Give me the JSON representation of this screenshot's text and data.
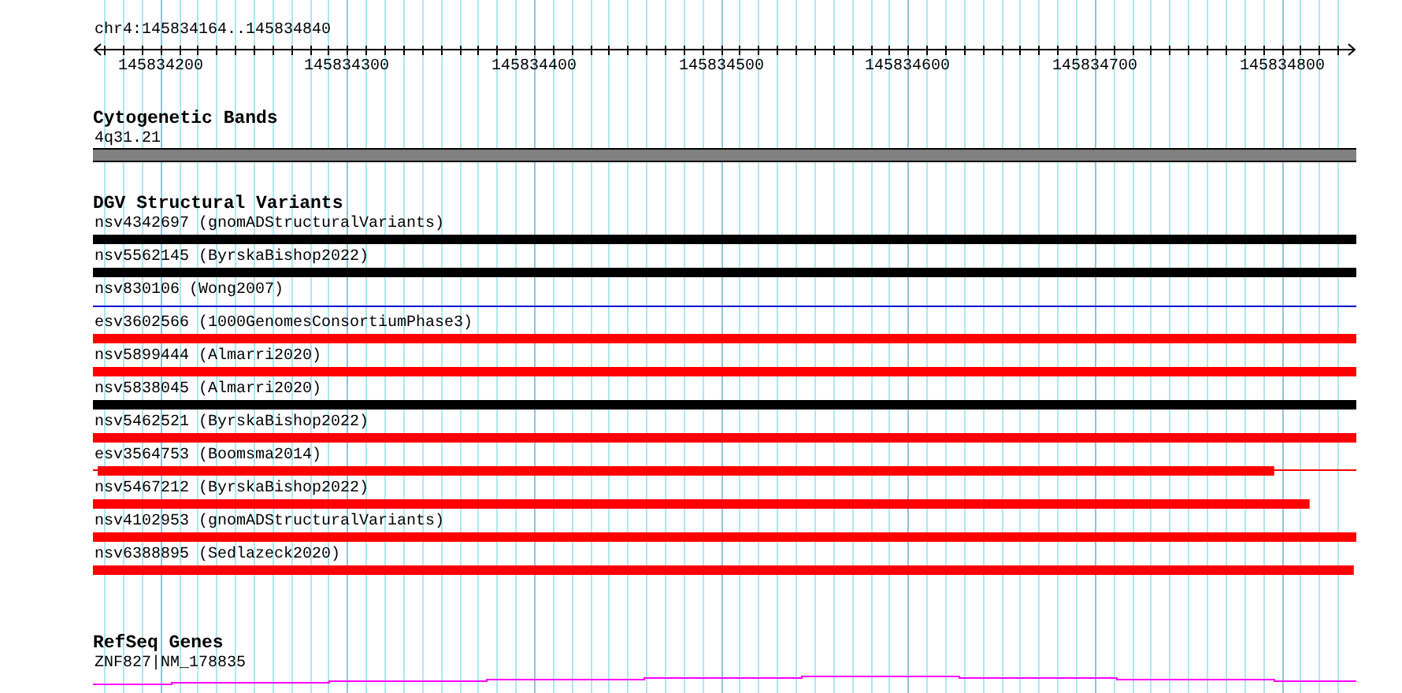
{
  "ruler": {
    "region": "chr4:145834164..145834840",
    "ticks": [
      "145834200",
      "145834300",
      "145834400",
      "145834500",
      "145834600",
      "145834700",
      "145834800"
    ]
  },
  "tracks": [
    {
      "kind": "bands",
      "title": "Cytogenetic Bands",
      "features": [
        {
          "label": "4q31.21",
          "kind": "band",
          "color": "#808080"
        }
      ]
    },
    {
      "kind": "variants",
      "title": "DGV Structural Variants",
      "features": [
        {
          "label": "nsv4342697 (gnomADStructuralVariants)",
          "kind": "bar",
          "color": "#000000"
        },
        {
          "label": "nsv5562145 (ByrskaBishop2022)",
          "kind": "bar",
          "color": "#000000"
        },
        {
          "label": "nsv830106 (Wong2007)",
          "kind": "line",
          "color": "#0000cc"
        },
        {
          "label": "esv3602566 (1000GenomesConsortiumPhase3)",
          "kind": "bar",
          "color": "#ff0000"
        },
        {
          "label": "nsv5899444 (Almarri2020)",
          "kind": "bar",
          "color": "#ff0000"
        },
        {
          "label": "nsv5838045 (Almarri2020)",
          "kind": "bar",
          "color": "#000000"
        },
        {
          "label": "nsv5462521 (ByrskaBishop2022)",
          "kind": "bar",
          "color": "#ff0000"
        },
        {
          "label": "esv3564753 (Boomsma2014)",
          "kind": "tailed",
          "color": "#ff0000",
          "level": 0.935
        },
        {
          "label": "nsv5467212 (ByrskaBishop2022)",
          "kind": "bar",
          "color": "#ff0000",
          "level": 0.963
        },
        {
          "label": "nsv4102953 (gnomADStructuralVariants)",
          "kind": "bar",
          "color": "#ff0000"
        },
        {
          "label": "nsv6388895 (Sedlazeck2020)",
          "kind": "bar",
          "color": "#ff0000",
          "level": 0.998
        }
      ]
    },
    {
      "kind": "genes",
      "title": "RefSeq Genes",
      "features": [
        {
          "label": "ZNF827|NM_178835",
          "kind": "gene",
          "color": "#ff00ff"
        }
      ]
    }
  ]
}
